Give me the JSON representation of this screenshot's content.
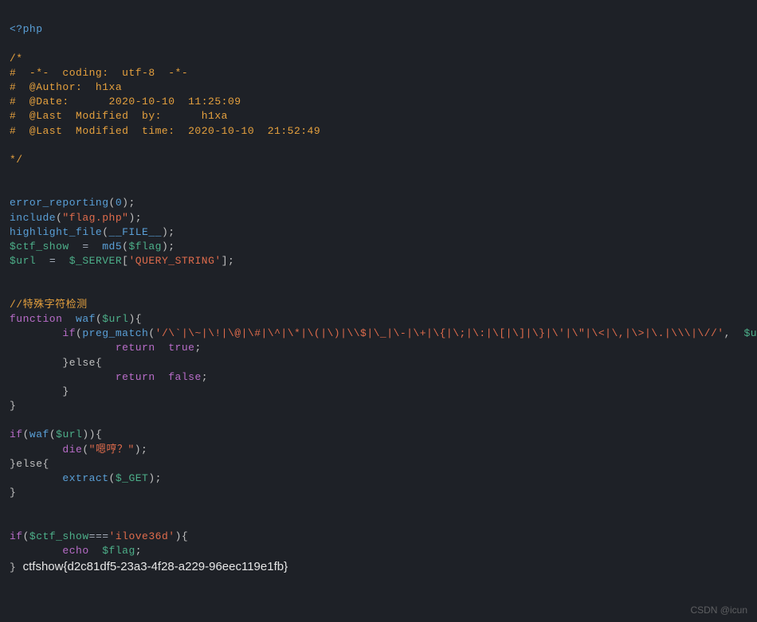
{
  "code": {
    "open_tag": "<?php",
    "comment_block": [
      "/*",
      "#  -*-  coding:  utf-8  -*-",
      "#  @Author:  h1xa",
      "#  @Date:      2020-10-10  11:25:09",
      "#  @Last  Modified  by:      h1xa",
      "#  @Last  Modified  time:  2020-10-10  21:52:49",
      "",
      "*/"
    ],
    "err_func": "error_reporting",
    "zero": "0",
    "include_func": "include",
    "include_arg": "\"flag.php\"",
    "hl_func": "highlight_file",
    "file_const": "__FILE__",
    "var_ctf": "$ctf_show",
    "md5_func": "md5",
    "var_flag": "$flag",
    "var_url": "$url",
    "server_var": "$_SERVER",
    "query_str": "'QUERY_STRING'",
    "cmt_special": "//特殊字符检测",
    "kw_function": "function",
    "fn_waf": "waf",
    "kw_if": "if",
    "preg_func": "preg_match",
    "regex": "'/\\`|\\~|\\!|\\@|\\#|\\^|\\*|\\(|\\)|\\\\$|\\_|\\-|\\+|\\{|\\;|\\:|\\[|\\]|\\}|\\'|\\\"|\\<|\\,|\\>|\\.|\\\\\\|\\//'",
    "kw_return": "return",
    "kw_true": "true",
    "kw_else": "}else{",
    "kw_false": "false",
    "die_func": "die",
    "die_arg": "\"嗯哼？\"",
    "extract_func": "extract",
    "get_var": "$_GET",
    "cmp": "===",
    "ilove": "'ilove36d'",
    "kw_echo": "echo",
    "flag_output": "ctfshow{d2c81df5-23a3-4f28-a229-96eec119e1fb}"
  },
  "watermark": "CSDN @icun"
}
